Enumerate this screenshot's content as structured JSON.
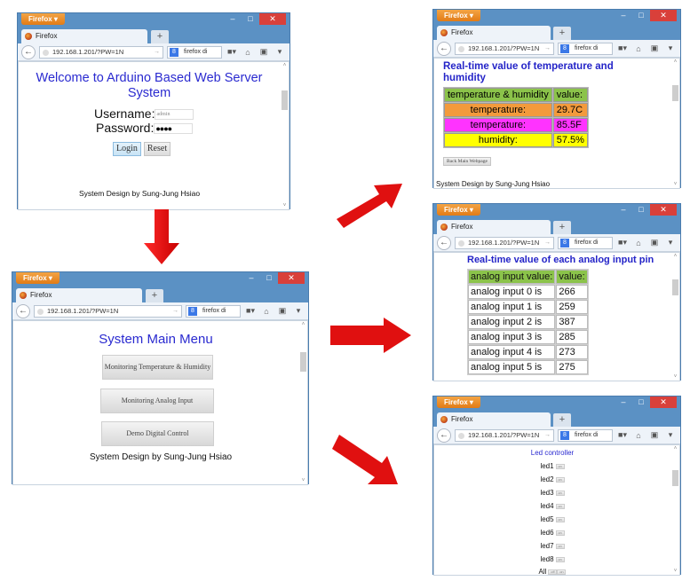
{
  "browser": {
    "app_button": "Firefox ▾",
    "tab_title": "Firefox",
    "new_tab": "+",
    "url": "192.168.1.201/?PW=1N",
    "search_engine_icon": "8",
    "search_text": "firefox di",
    "controls": {
      "minimize": "–",
      "maximize": "□",
      "close": "✕"
    },
    "icons": {
      "back": "←",
      "dropdown": "▿",
      "go": "→",
      "search": "⚲",
      "bookmarks": "■▾",
      "home": "⌂",
      "pocket": "▣",
      "menu": "▾",
      "scroll_up": "˄",
      "scroll_down": "˅"
    }
  },
  "colors": {
    "accent": "#2a2ad0",
    "header_green": "#8bc34a",
    "temp_c_orange": "#f39a3c",
    "temp_f_magenta": "#ff33ff",
    "humidity_yellow": "#ffff00",
    "arrow_red": "#e01010"
  },
  "login": {
    "title": "Welcome to Arduino Based Web Server System",
    "username_label": "Username:",
    "username_value": "admin",
    "password_label": "Password:",
    "password_value": "●●●●",
    "login_button": "Login",
    "reset_button": "Reset",
    "footer": "System Design by Sung-Jung Hsiao"
  },
  "main_menu": {
    "title": "System Main Menu",
    "buttons": [
      "Monitoring Temperature & Humidity",
      "Monitoring Analog Input",
      "Demo Digital Control"
    ],
    "footer": "System Design by Sung-Jung Hsiao"
  },
  "temp_humidity": {
    "title": "Real-time value of temperature and humidity",
    "header": [
      "temperature & humidity",
      "value:"
    ],
    "rows": [
      {
        "label": "temperature:",
        "value": "29.7C"
      },
      {
        "label": "temperature:",
        "value": "85.5F"
      },
      {
        "label": "humidity:",
        "value": "57.5%"
      }
    ],
    "back_button": "Back Main Webpage",
    "footer": "System Design by Sung-Jung Hsiao"
  },
  "analog": {
    "title": "Real-time value of each analog input pin",
    "header": [
      "analog input value:",
      "value:"
    ],
    "rows": [
      {
        "label": "analog input 0 is",
        "value": "266"
      },
      {
        "label": "analog input 1 is",
        "value": "259"
      },
      {
        "label": "analog input 2 is",
        "value": "387"
      },
      {
        "label": "analog input 3 is",
        "value": "285"
      },
      {
        "label": "analog input 4 is",
        "value": "273"
      },
      {
        "label": "analog input 5 is",
        "value": "275"
      }
    ]
  },
  "led": {
    "title": "Led controller",
    "rows": [
      "led1",
      "led2",
      "led3",
      "led4",
      "led5",
      "led6",
      "led7",
      "led8"
    ],
    "button_label": "on",
    "all_label": "All",
    "all_buttons": [
      "off",
      "on"
    ]
  }
}
